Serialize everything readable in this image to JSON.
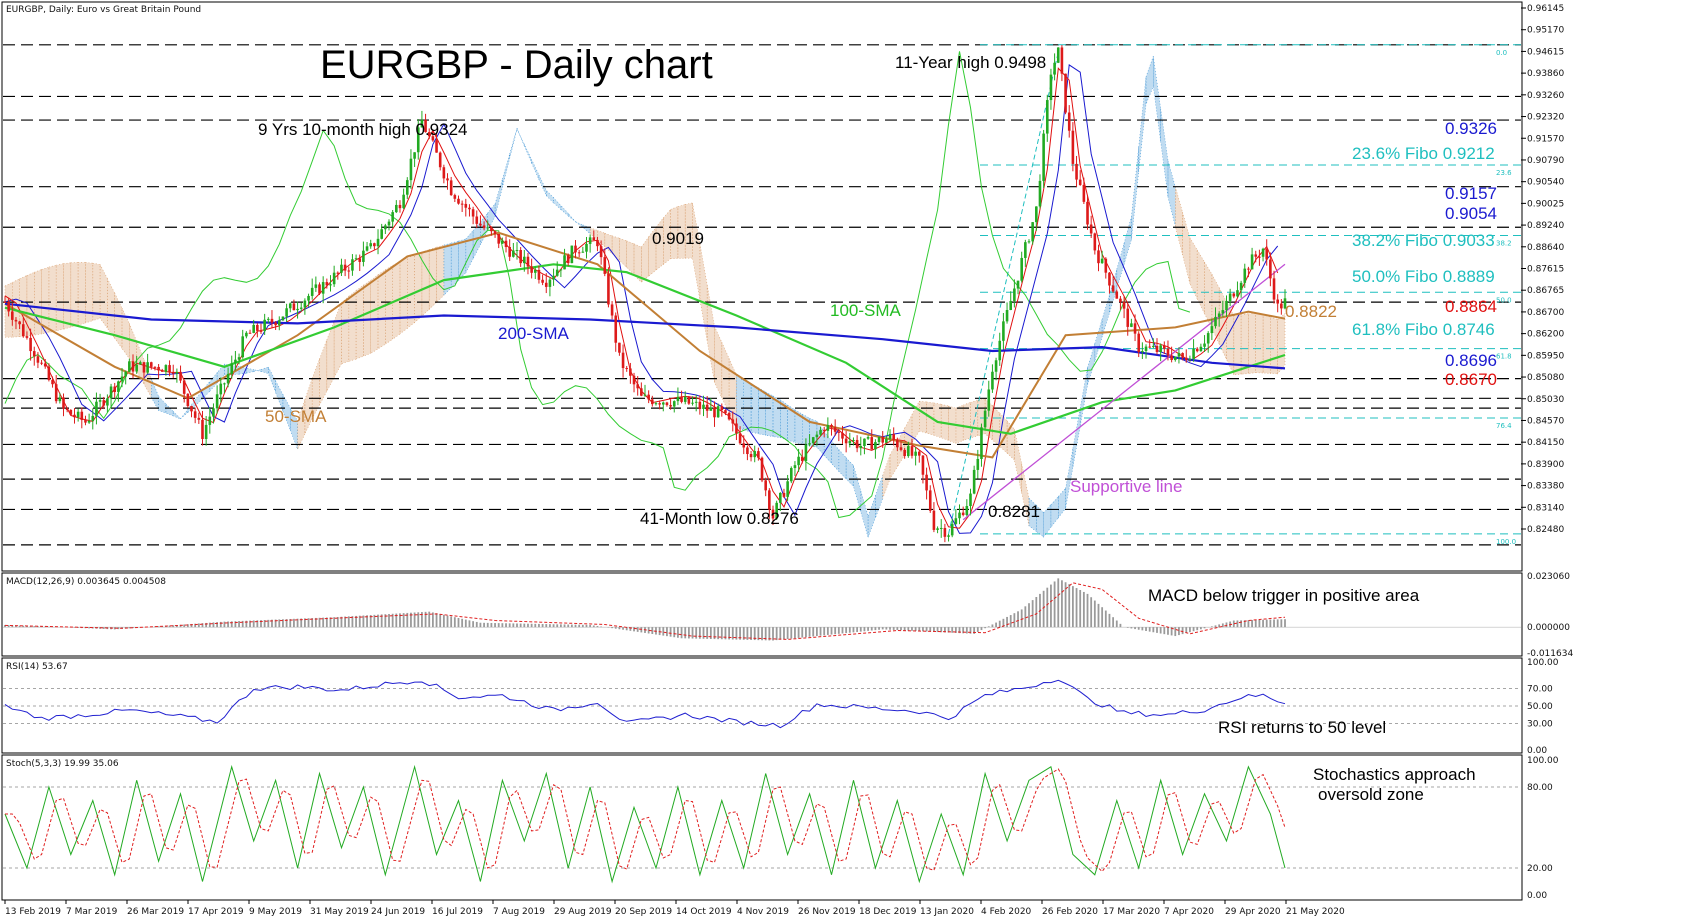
{
  "header": {
    "symbol_line": "EURGBP, Daily:  Euro vs Great Britain Pound",
    "macd_label": "MACD(12,26,9) 0.003645 0.004508",
    "rsi_label": "RSI(14) 53.67",
    "stoch_label": "Stoch(5,3,3) 19.99 35.06"
  },
  "chart_data": [
    {
      "type": "candlestick",
      "title": "EURGBP - Daily chart",
      "ylim": [
        0.823,
        0.9618
      ],
      "x_tick_labels": [
        "13 Feb 2019",
        "7 Mar 2019",
        "26 Mar 2019",
        "17 Apr 2019",
        "9 May 2019",
        "31 May 2019",
        "24 Jun 2019",
        "16 Jul 2019",
        "7 Aug 2019",
        "29 Aug 2019",
        "20 Sep 2019",
        "14 Oct 2019",
        "4 Nov 2019",
        "26 Nov 2019",
        "18 Dec 2019",
        "13 Jan 2020",
        "4 Feb 2020",
        "26 Feb 2020",
        "17 Mar 2020",
        "7 Apr 2020",
        "29 Apr 2020",
        "21 May 2020"
      ],
      "y_tick_labels": [
        "0.96145",
        "0.95170",
        "0.94615",
        "0.93860",
        "0.93260",
        "0.92320",
        "0.91570",
        "0.90790",
        "0.90540",
        "0.90025",
        "0.89240",
        "0.88640",
        "0.87615",
        "0.86765",
        "0.86700",
        "0.86200",
        "0.85950",
        "0.85080",
        "0.85030",
        "0.84570",
        "0.84150",
        "0.83900",
        "0.83380",
        "0.83140",
        "0.82480"
      ],
      "price_path": [
        [
          0,
          0.8865
        ],
        [
          8,
          0.874
        ],
        [
          16,
          0.859
        ],
        [
          22,
          0.856
        ],
        [
          34,
          0.87
        ],
        [
          46,
          0.87
        ],
        [
          54,
          0.853
        ],
        [
          58,
          0.862
        ],
        [
          66,
          0.878
        ],
        [
          74,
          0.882
        ],
        [
          86,
          0.89
        ],
        [
          100,
          0.9
        ],
        [
          108,
          0.912
        ],
        [
          114,
          0.9324
        ],
        [
          122,
          0.915
        ],
        [
          130,
          0.906
        ],
        [
          140,
          0.898
        ],
        [
          148,
          0.892
        ],
        [
          156,
          0.9
        ],
        [
          162,
          0.9019
        ],
        [
          168,
          0.872
        ],
        [
          174,
          0.862
        ],
        [
          186,
          0.861
        ],
        [
          196,
          0.858
        ],
        [
          206,
          0.846
        ],
        [
          210,
          0.832
        ],
        [
          216,
          0.845
        ],
        [
          224,
          0.855
        ],
        [
          234,
          0.85
        ],
        [
          242,
          0.852
        ],
        [
          250,
          0.846
        ],
        [
          254,
          0.83
        ],
        [
          258,
          0.8281
        ],
        [
          264,
          0.837
        ],
        [
          270,
          0.87
        ],
        [
          276,
          0.89
        ],
        [
          282,
          0.91
        ],
        [
          286,
          0.945
        ],
        [
          288,
          0.9498
        ],
        [
          292,
          0.922
        ],
        [
          298,
          0.9
        ],
        [
          304,
          0.888
        ],
        [
          310,
          0.875
        ],
        [
          316,
          0.874
        ],
        [
          322,
          0.872
        ],
        [
          328,
          0.877
        ],
        [
          334,
          0.886
        ],
        [
          340,
          0.896
        ],
        [
          344,
          0.9
        ],
        [
          348,
          0.885
        ],
        [
          350,
          0.8864
        ]
      ],
      "sma_50": [
        [
          0,
          0.886
        ],
        [
          30,
          0.87
        ],
        [
          50,
          0.862
        ],
        [
          80,
          0.878
        ],
        [
          110,
          0.898
        ],
        [
          135,
          0.904
        ],
        [
          162,
          0.896
        ],
        [
          190,
          0.874
        ],
        [
          220,
          0.856
        ],
        [
          250,
          0.85
        ],
        [
          270,
          0.847
        ],
        [
          290,
          0.878
        ],
        [
          320,
          0.88
        ],
        [
          340,
          0.884
        ],
        [
          350,
          0.8822
        ]
      ],
      "sma_100": [
        [
          0,
          0.885
        ],
        [
          30,
          0.878
        ],
        [
          60,
          0.87
        ],
        [
          90,
          0.88
        ],
        [
          120,
          0.892
        ],
        [
          150,
          0.896
        ],
        [
          170,
          0.894
        ],
        [
          200,
          0.883
        ],
        [
          230,
          0.871
        ],
        [
          255,
          0.856
        ],
        [
          275,
          0.853
        ],
        [
          300,
          0.861
        ],
        [
          320,
          0.864
        ],
        [
          340,
          0.87
        ],
        [
          350,
          0.873
        ]
      ],
      "sma_200": [
        [
          0,
          0.886
        ],
        [
          40,
          0.882
        ],
        [
          80,
          0.881
        ],
        [
          120,
          0.883
        ],
        [
          160,
          0.882
        ],
        [
          200,
          0.88
        ],
        [
          240,
          0.877
        ],
        [
          270,
          0.874
        ],
        [
          300,
          0.875
        ],
        [
          330,
          0.871
        ],
        [
          350,
          0.8696
        ]
      ],
      "horizontal_levels": [
        0.9517,
        0.9386,
        0.9326,
        0.9157,
        0.9054,
        0.8864,
        0.867,
        0.862,
        0.8595,
        0.8503,
        0.8415,
        0.8338,
        0.8248
      ],
      "fibo_levels": [
        {
          "label": "0.0",
          "value": 0.9517
        },
        {
          "label": "23.6",
          "value": 0.9212
        },
        {
          "label": "38.2",
          "value": 0.9033
        },
        {
          "label": "50.0",
          "value": 0.8889
        },
        {
          "label": "61.8",
          "value": 0.8746
        },
        {
          "label": "76.4",
          "value": 0.857
        },
        {
          "label": "100.0",
          "value": 0.8276
        }
      ],
      "supportive_line": [
        [
          262,
          0.8312
        ],
        [
          350,
          0.896
        ]
      ],
      "annotations": [
        {
          "text": "11-Year high 0.9498",
          "color": "#000000"
        },
        {
          "text": "9 Yrs 10-month high 0.9324",
          "color": "#000000"
        },
        {
          "text": "0.9019",
          "color": "#000000"
        },
        {
          "text": "41-Month low 0.8276",
          "color": "#000000"
        },
        {
          "text": "0.8281",
          "color": "#000000"
        },
        {
          "text": "100-SMA",
          "color": "#22bb22"
        },
        {
          "text": "200-SMA",
          "color": "#1a1ad0"
        },
        {
          "text": "50-SMA",
          "color": "#c27f35"
        },
        {
          "text": "Supportive line",
          "color": "#c04fd6"
        },
        {
          "text": "0.9326",
          "color": "#1a1ad0"
        },
        {
          "text": "23.6% Fibo 0.9212",
          "color": "#1fbfbf"
        },
        {
          "text": "0.9157",
          "color": "#1a1ad0"
        },
        {
          "text": "0.9054",
          "color": "#1a1ad0"
        },
        {
          "text": "38.2% Fibo 0.9033",
          "color": "#1fbfbf"
        },
        {
          "text": "50.0% Fibo 0.8889",
          "color": "#1fbfbf"
        },
        {
          "text": "0.8864",
          "color": "#e01010"
        },
        {
          "text": "0.8822",
          "color": "#c27f35"
        },
        {
          "text": "61.8% Fibo 0.8746",
          "color": "#1fbfbf"
        },
        {
          "text": "0.8696",
          "color": "#1a1ad0"
        },
        {
          "text": "0.8670",
          "color": "#e01010"
        }
      ]
    },
    {
      "type": "bar",
      "title": "MACD(12,26,9) 0.003645 0.004508",
      "ylim": [
        -0.011634,
        0.02306
      ],
      "y_tick_labels": [
        "0.023060",
        "0.000000",
        "-0.011634"
      ],
      "macd_path": [
        [
          0,
          0.001
        ],
        [
          30,
          -0.001
        ],
        [
          60,
          0.0025
        ],
        [
          90,
          0.0045
        ],
        [
          116,
          0.007
        ],
        [
          130,
          0.002
        ],
        [
          160,
          0.001
        ],
        [
          185,
          -0.005
        ],
        [
          210,
          -0.006
        ],
        [
          240,
          -0.001
        ],
        [
          265,
          -0.003
        ],
        [
          278,
          0.008
        ],
        [
          288,
          0.022
        ],
        [
          296,
          0.015
        ],
        [
          306,
          0.0
        ],
        [
          320,
          -0.004
        ],
        [
          336,
          0.003
        ],
        [
          350,
          0.0036
        ]
      ],
      "signal_path": [
        [
          0,
          0.0008
        ],
        [
          32,
          -0.0005
        ],
        [
          62,
          0.002
        ],
        [
          92,
          0.0042
        ],
        [
          118,
          0.006
        ],
        [
          134,
          0.003
        ],
        [
          164,
          0.0012
        ],
        [
          188,
          -0.004
        ],
        [
          214,
          -0.0055
        ],
        [
          244,
          -0.0015
        ],
        [
          268,
          -0.0025
        ],
        [
          282,
          0.006
        ],
        [
          292,
          0.02
        ],
        [
          300,
          0.017
        ],
        [
          310,
          0.004
        ],
        [
          324,
          -0.003
        ],
        [
          340,
          0.003
        ],
        [
          350,
          0.0045
        ]
      ],
      "annotations": [
        {
          "text": "MACD below trigger in positive area",
          "color": "#000000"
        }
      ]
    },
    {
      "type": "line",
      "title": "RSI(14) 53.67",
      "ylim": [
        0,
        100
      ],
      "y_tick_labels": [
        "100.00",
        "70.00",
        "50.00",
        "30.00",
        "0.00"
      ],
      "levels": [
        70,
        50,
        30
      ],
      "rsi_path": [
        [
          0,
          50
        ],
        [
          10,
          36
        ],
        [
          22,
          40
        ],
        [
          34,
          45
        ],
        [
          48,
          38
        ],
        [
          58,
          32
        ],
        [
          68,
          70
        ],
        [
          80,
          72
        ],
        [
          92,
          68
        ],
        [
          106,
          76
        ],
        [
          114,
          80
        ],
        [
          124,
          60
        ],
        [
          136,
          62
        ],
        [
          150,
          45
        ],
        [
          162,
          55
        ],
        [
          170,
          30
        ],
        [
          186,
          40
        ],
        [
          200,
          32
        ],
        [
          212,
          28
        ],
        [
          222,
          52
        ],
        [
          236,
          48
        ],
        [
          250,
          44
        ],
        [
          258,
          36
        ],
        [
          268,
          62
        ],
        [
          280,
          72
        ],
        [
          288,
          82
        ],
        [
          296,
          58
        ],
        [
          306,
          42
        ],
        [
          318,
          40
        ],
        [
          328,
          46
        ],
        [
          338,
          60
        ],
        [
          344,
          62
        ],
        [
          350,
          53.67
        ]
      ],
      "annotations": [
        {
          "text": "RSI returns to 50 level",
          "color": "#000000"
        }
      ]
    },
    {
      "type": "line",
      "title": "Stoch(5,3,3) 19.99 35.06",
      "ylim": [
        0,
        100
      ],
      "y_tick_labels": [
        "100.00",
        "80.00",
        "20.00",
        "0.00"
      ],
      "levels": [
        80,
        20
      ],
      "stoch_k_path": [
        [
          0,
          60
        ],
        [
          6,
          20
        ],
        [
          12,
          80
        ],
        [
          18,
          30
        ],
        [
          24,
          70
        ],
        [
          30,
          15
        ],
        [
          36,
          85
        ],
        [
          42,
          25
        ],
        [
          48,
          75
        ],
        [
          54,
          10
        ],
        [
          62,
          95
        ],
        [
          68,
          40
        ],
        [
          74,
          85
        ],
        [
          80,
          20
        ],
        [
          86,
          90
        ],
        [
          92,
          35
        ],
        [
          98,
          80
        ],
        [
          104,
          15
        ],
        [
          112,
          95
        ],
        [
          118,
          30
        ],
        [
          124,
          70
        ],
        [
          130,
          10
        ],
        [
          136,
          85
        ],
        [
          142,
          40
        ],
        [
          148,
          90
        ],
        [
          154,
          20
        ],
        [
          160,
          80
        ],
        [
          166,
          10
        ],
        [
          172,
          65
        ],
        [
          178,
          20
        ],
        [
          184,
          80
        ],
        [
          190,
          15
        ],
        [
          196,
          70
        ],
        [
          202,
          20
        ],
        [
          208,
          90
        ],
        [
          214,
          30
        ],
        [
          220,
          75
        ],
        [
          226,
          15
        ],
        [
          232,
          85
        ],
        [
          238,
          20
        ],
        [
          244,
          70
        ],
        [
          250,
          10
        ],
        [
          256,
          60
        ],
        [
          262,
          15
        ],
        [
          268,
          90
        ],
        [
          274,
          40
        ],
        [
          280,
          85
        ],
        [
          286,
          95
        ],
        [
          292,
          30
        ],
        [
          298,
          15
        ],
        [
          304,
          70
        ],
        [
          310,
          20
        ],
        [
          316,
          85
        ],
        [
          322,
          30
        ],
        [
          328,
          75
        ],
        [
          334,
          40
        ],
        [
          340,
          95
        ],
        [
          346,
          60
        ],
        [
          350,
          19.99
        ]
      ],
      "annotations": [
        {
          "text": "Stochastics approach",
          "color": "#000000"
        },
        {
          "text": "oversold zone",
          "color": "#000000"
        }
      ]
    }
  ],
  "colors": {
    "candle_up": "#22aa22",
    "candle_down": "#dd1a1a",
    "kijun": "#1a1ad0",
    "tenkan": "#e01010",
    "chikou": "#33cc33",
    "cloud_bull": "#d9a070",
    "cloud_bear": "#4a9ad6",
    "level_line": "#000000",
    "fibo_line": "#1fbfbf",
    "macd_hist": "#9a9a9a",
    "macd_signal": "#e02020",
    "rsi_line": "#2020d0",
    "stoch_k": "#22aa22",
    "stoch_d": "#e02020"
  }
}
